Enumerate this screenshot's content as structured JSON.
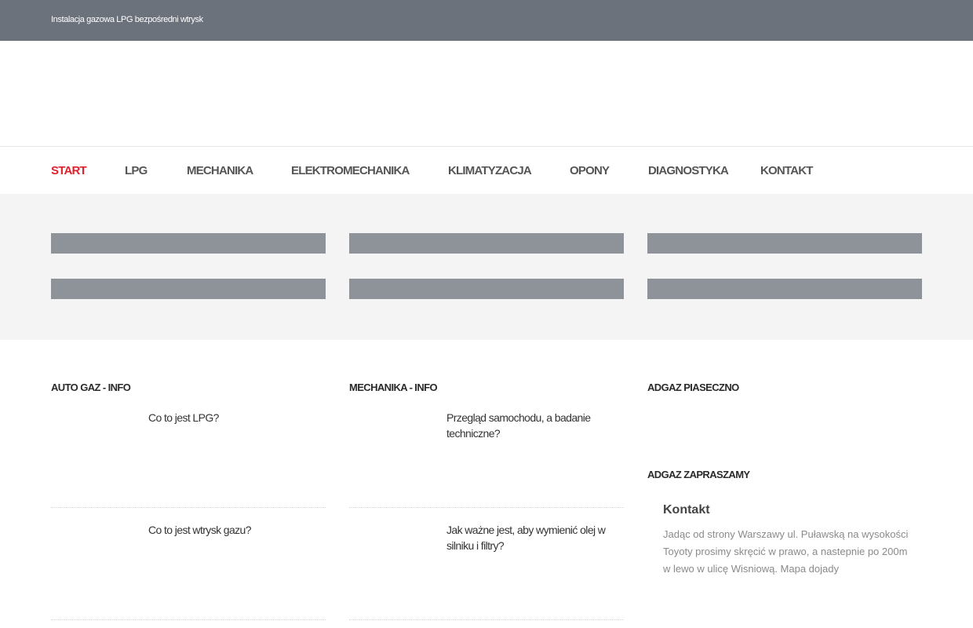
{
  "topbar": {
    "tagline": "Instalacja gazowa LPG bezpośredni wtrysk"
  },
  "nav": {
    "items": [
      {
        "label": "START",
        "active": true
      },
      {
        "label": "LPG"
      },
      {
        "label": "MECHANIKA"
      },
      {
        "label": "ELEKTROMECHANIKA"
      },
      {
        "label": "KLIMATYZACJA"
      },
      {
        "label": "OPONY"
      },
      {
        "label": "DIAGNOSTYKA"
      },
      {
        "label": "KONTAKT"
      }
    ]
  },
  "colors": {
    "accent": "#e0202b",
    "topbar": "#6c727c",
    "band": "#f4f4f4",
    "bar": "#8e939a"
  },
  "sections": {
    "autogaz": {
      "title": "AUTO GAZ - INFO",
      "posts": [
        {
          "title": "Co to jest LPG?"
        },
        {
          "title": "Co to jest wtrysk gazu?"
        }
      ]
    },
    "mechanika": {
      "title": "MECHANIKA - INFO",
      "posts": [
        {
          "title": "Przegląd samochodu, a badanie techniczne?"
        },
        {
          "title": "Jak ważne jest, aby wymienić olej w silniku i filtry?"
        }
      ]
    },
    "adgaz": {
      "title": "ADGAZ PIASECZNO"
    },
    "zapraszamy": {
      "title": "ADGAZ ZAPRASZAMY",
      "contact_title": "Kontakt",
      "contact_text": "Jadąc od strony Warszawy ul. Puławską na wysokości Toyoty prosimy skręcić w prawo, a nastepnie po 200m w lewo w ulicę Wisniową. Mapa dojady"
    }
  }
}
